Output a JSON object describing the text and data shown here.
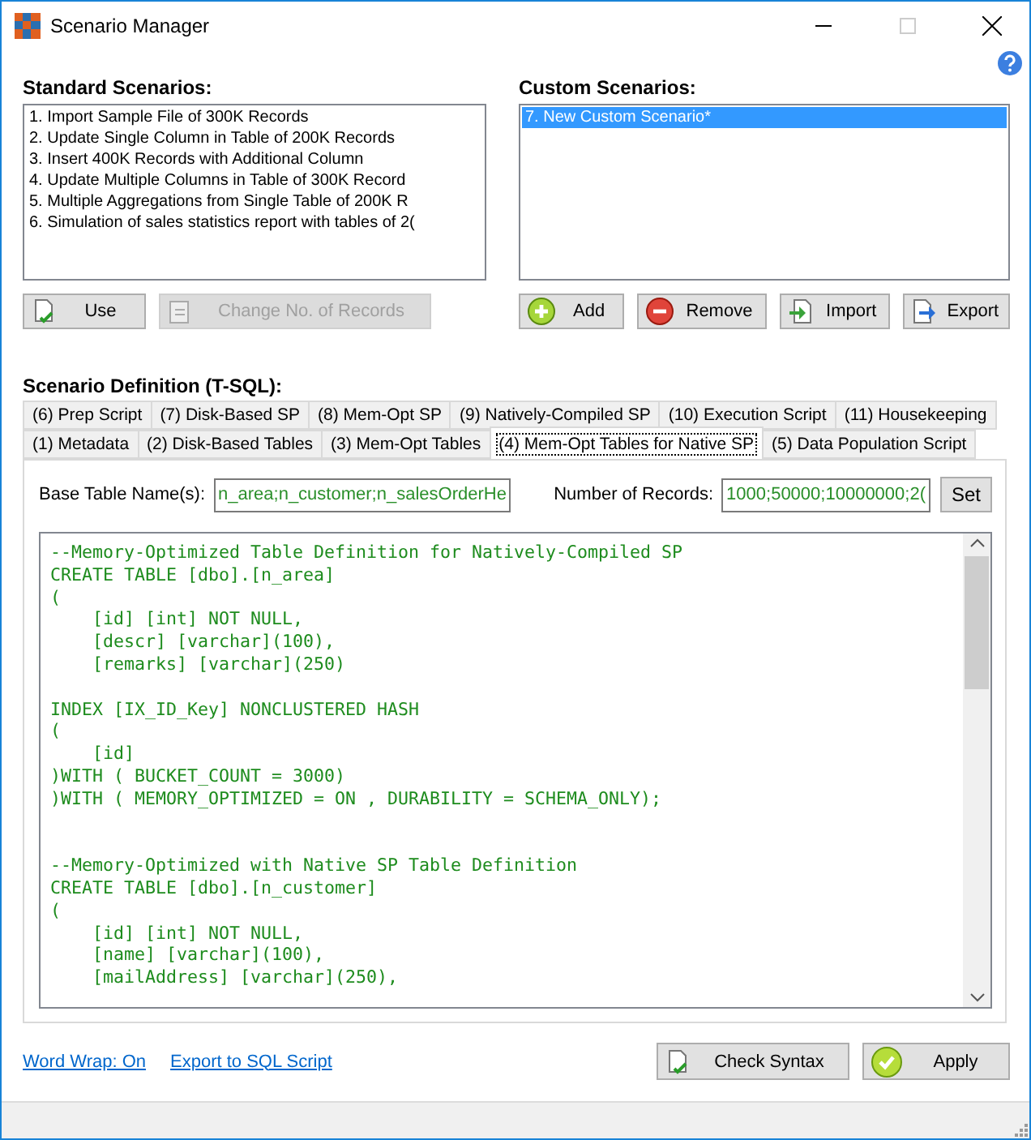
{
  "window": {
    "title": "Scenario Manager"
  },
  "standard_scenarios": {
    "label": "Standard Scenarios:",
    "items": [
      {
        "text": "1. Import Sample File of 300K Records",
        "selected": false
      },
      {
        "text": "2. Update Single Column in Table of 200K Records",
        "selected": false
      },
      {
        "text": "3. Insert 400K Records with Additional Column",
        "selected": false
      },
      {
        "text": "4. Update Multiple Columns in Table of 300K Record",
        "selected": false
      },
      {
        "text": "5. Multiple Aggregations from Single Table of 200K R",
        "selected": false
      },
      {
        "text": "6. Simulation of sales statistics report with tables of 2(",
        "selected": false
      }
    ],
    "buttons": [
      {
        "label": "Use",
        "disabled": false
      },
      {
        "label": "Change No. of Records",
        "disabled": true
      }
    ]
  },
  "custom_scenarios": {
    "label": "Custom Scenarios:",
    "items": [
      {
        "text": "7. New Custom Scenario*",
        "selected": true
      }
    ],
    "buttons": [
      {
        "label": "Add",
        "disabled": false
      },
      {
        "label": "Remove",
        "disabled": false
      },
      {
        "label": "Import",
        "disabled": false
      },
      {
        "label": "Export",
        "disabled": false
      }
    ]
  },
  "definition": {
    "label": "Scenario Definition (T-SQL):",
    "tabs_back_row": [
      {
        "label": "(6) Prep Script",
        "selected": false
      },
      {
        "label": "(7) Disk-Based SP",
        "selected": false
      },
      {
        "label": "(8) Mem-Opt SP",
        "selected": false
      },
      {
        "label": "(9) Natively-Compiled SP",
        "selected": false
      },
      {
        "label": "(10) Execution Script",
        "selected": false
      },
      {
        "label": "(11) Housekeeping",
        "selected": false
      }
    ],
    "tabs_front_row": [
      {
        "label": "(1) Metadata",
        "selected": false
      },
      {
        "label": "(2) Disk-Based Tables",
        "selected": false
      },
      {
        "label": "(3) Mem-Opt Tables",
        "selected": false
      },
      {
        "label": "(4) Mem-Opt Tables for Native SP",
        "selected": true
      },
      {
        "label": "(5) Data Population Script",
        "selected": false
      }
    ],
    "base_table": {
      "label": "Base Table Name(s):",
      "value": "n_area;n_customer;n_salesOrderHe"
    },
    "records": {
      "label": "Number of Records:",
      "value": "1000;50000;10000000;2(",
      "button": "Set"
    },
    "code": "--Memory-Optimized Table Definition for Natively-Compiled SP\nCREATE TABLE [dbo].[n_area]\n(\n    [id] [int] NOT NULL,\n    [descr] [varchar](100),\n    [remarks] [varchar](250)\n\nINDEX [IX_ID_Key] NONCLUSTERED HASH\n(\n    [id]\n)WITH ( BUCKET_COUNT = 3000)\n)WITH ( MEMORY_OPTIMIZED = ON , DURABILITY = SCHEMA_ONLY);\n\n\n--Memory-Optimized with Native SP Table Definition\nCREATE TABLE [dbo].[n_customer]\n(\n    [id] [int] NOT NULL,\n    [name] [varchar](100),\n    [mailAddress] [varchar](250),"
  },
  "links": [
    "Word Wrap: On",
    "Export to SQL Script"
  ],
  "actions": [
    "Check Syntax",
    "Apply"
  ]
}
